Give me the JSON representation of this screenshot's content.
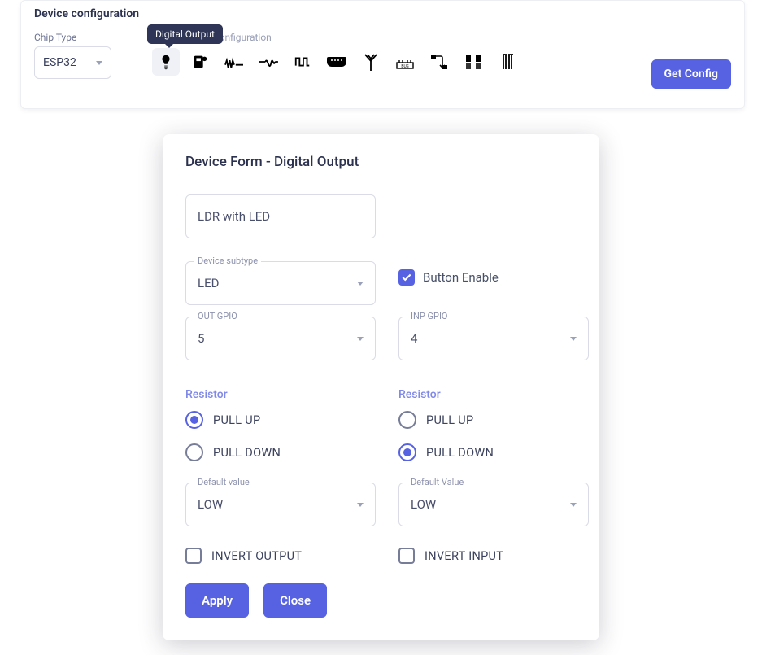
{
  "topPanel": {
    "title": "Device configuration",
    "chipTypeLabel": "Chip Type",
    "chipTypeValue": "ESP32",
    "newConfigLabel": "Select a New configuration",
    "tooltip": "Digital Output",
    "getConfigBtn": "Get Config"
  },
  "dialog": {
    "title": "Device Form - Digital Output",
    "nameValue": "LDR with LED",
    "subtypeLabel": "Device subtype",
    "subtypeValue": "LED",
    "buttonEnableLabel": "Button Enable",
    "buttonEnableChecked": true,
    "left": {
      "gpioLabel": "OUT GPIO",
      "gpioValue": "5",
      "resistorLabel": "Resistor",
      "pullUpLabel": "PULL UP",
      "pullDownLabel": "PULL DOWN",
      "resistorSelected": "up",
      "defaultLabel": "Default value",
      "defaultValue": "LOW",
      "invertLabel": "INVERT OUTPUT"
    },
    "right": {
      "gpioLabel": "INP GPIO",
      "gpioValue": "4",
      "resistorLabel": "Resistor",
      "pullUpLabel": "PULL UP",
      "pullDownLabel": "PULL DOWN",
      "resistorSelected": "down",
      "defaultLabel": "Default Value",
      "defaultValue": "LOW",
      "invertLabel": "INVERT INPUT"
    },
    "applyBtn": "Apply",
    "closeBtn": "Close"
  }
}
